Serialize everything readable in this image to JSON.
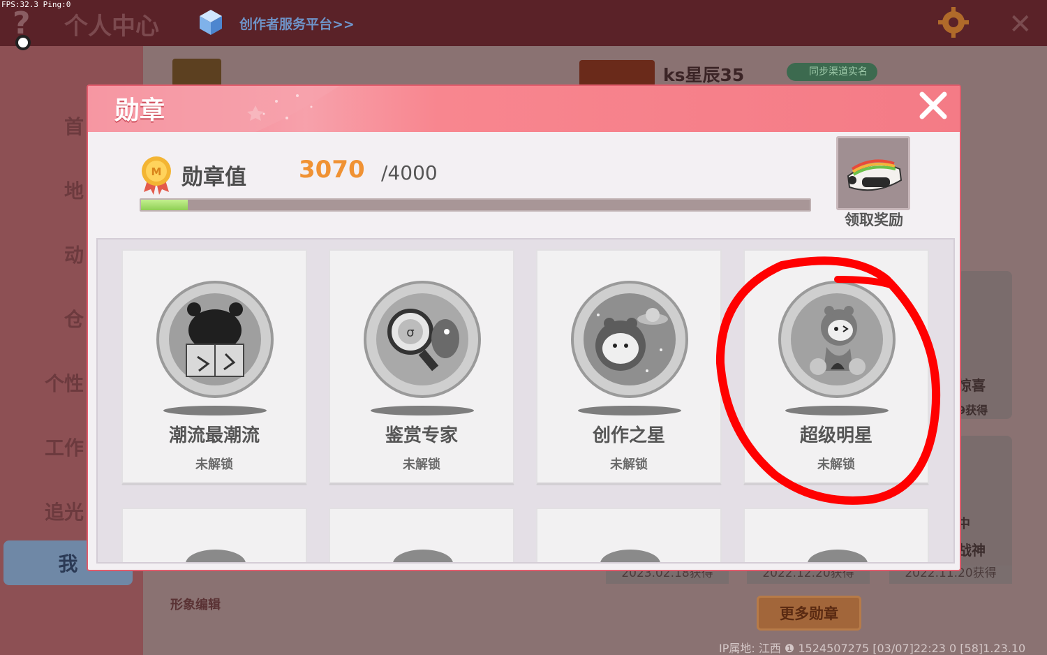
{
  "debug": {
    "fps_text": "FPS:32.3  Ping:0"
  },
  "background": {
    "window_title": "个人中心",
    "creator_link": "创作者服务平台>>",
    "player_name": "ks星辰35",
    "sync_button": "同步渠道实名",
    "sidebar": [
      "首",
      "地",
      "动",
      "仓",
      "个性",
      "工作",
      "追光",
      "我"
    ],
    "avatar_edit": "形象编辑",
    "right_texts": [
      "惊喜",
      "9获得",
      "中",
      "战神"
    ],
    "dates": [
      "2023.02.18获得",
      "2022.12.20获得",
      "2022.11.20获得"
    ],
    "more_medals": "更多勋章",
    "footer": "IP属地: 江西 ❶ 1524507275   [03/07]22:23 0  [58]1.23.10"
  },
  "modal": {
    "title": "勋章",
    "value_label": "勋章值",
    "value_current": "3070",
    "value_max": "/4000",
    "progress_fraction": 0.07,
    "reward_label": "领取奖励",
    "cards": [
      {
        "name": "潮流最潮流",
        "status": "未解锁",
        "icon": "bear-reading-medal-icon"
      },
      {
        "name": "鉴赏专家",
        "status": "未解锁",
        "icon": "magnifier-medal-icon"
      },
      {
        "name": "创作之星",
        "status": "未解锁",
        "icon": "astronaut-medal-icon"
      },
      {
        "name": "超级明星",
        "status": "未解锁",
        "icon": "star-dancer-medal-icon"
      }
    ]
  },
  "colors": {
    "header": "#f47b86",
    "value_accent": "#f09233",
    "progress_fill": "#8fcf55",
    "annotation": "#ff0000"
  }
}
